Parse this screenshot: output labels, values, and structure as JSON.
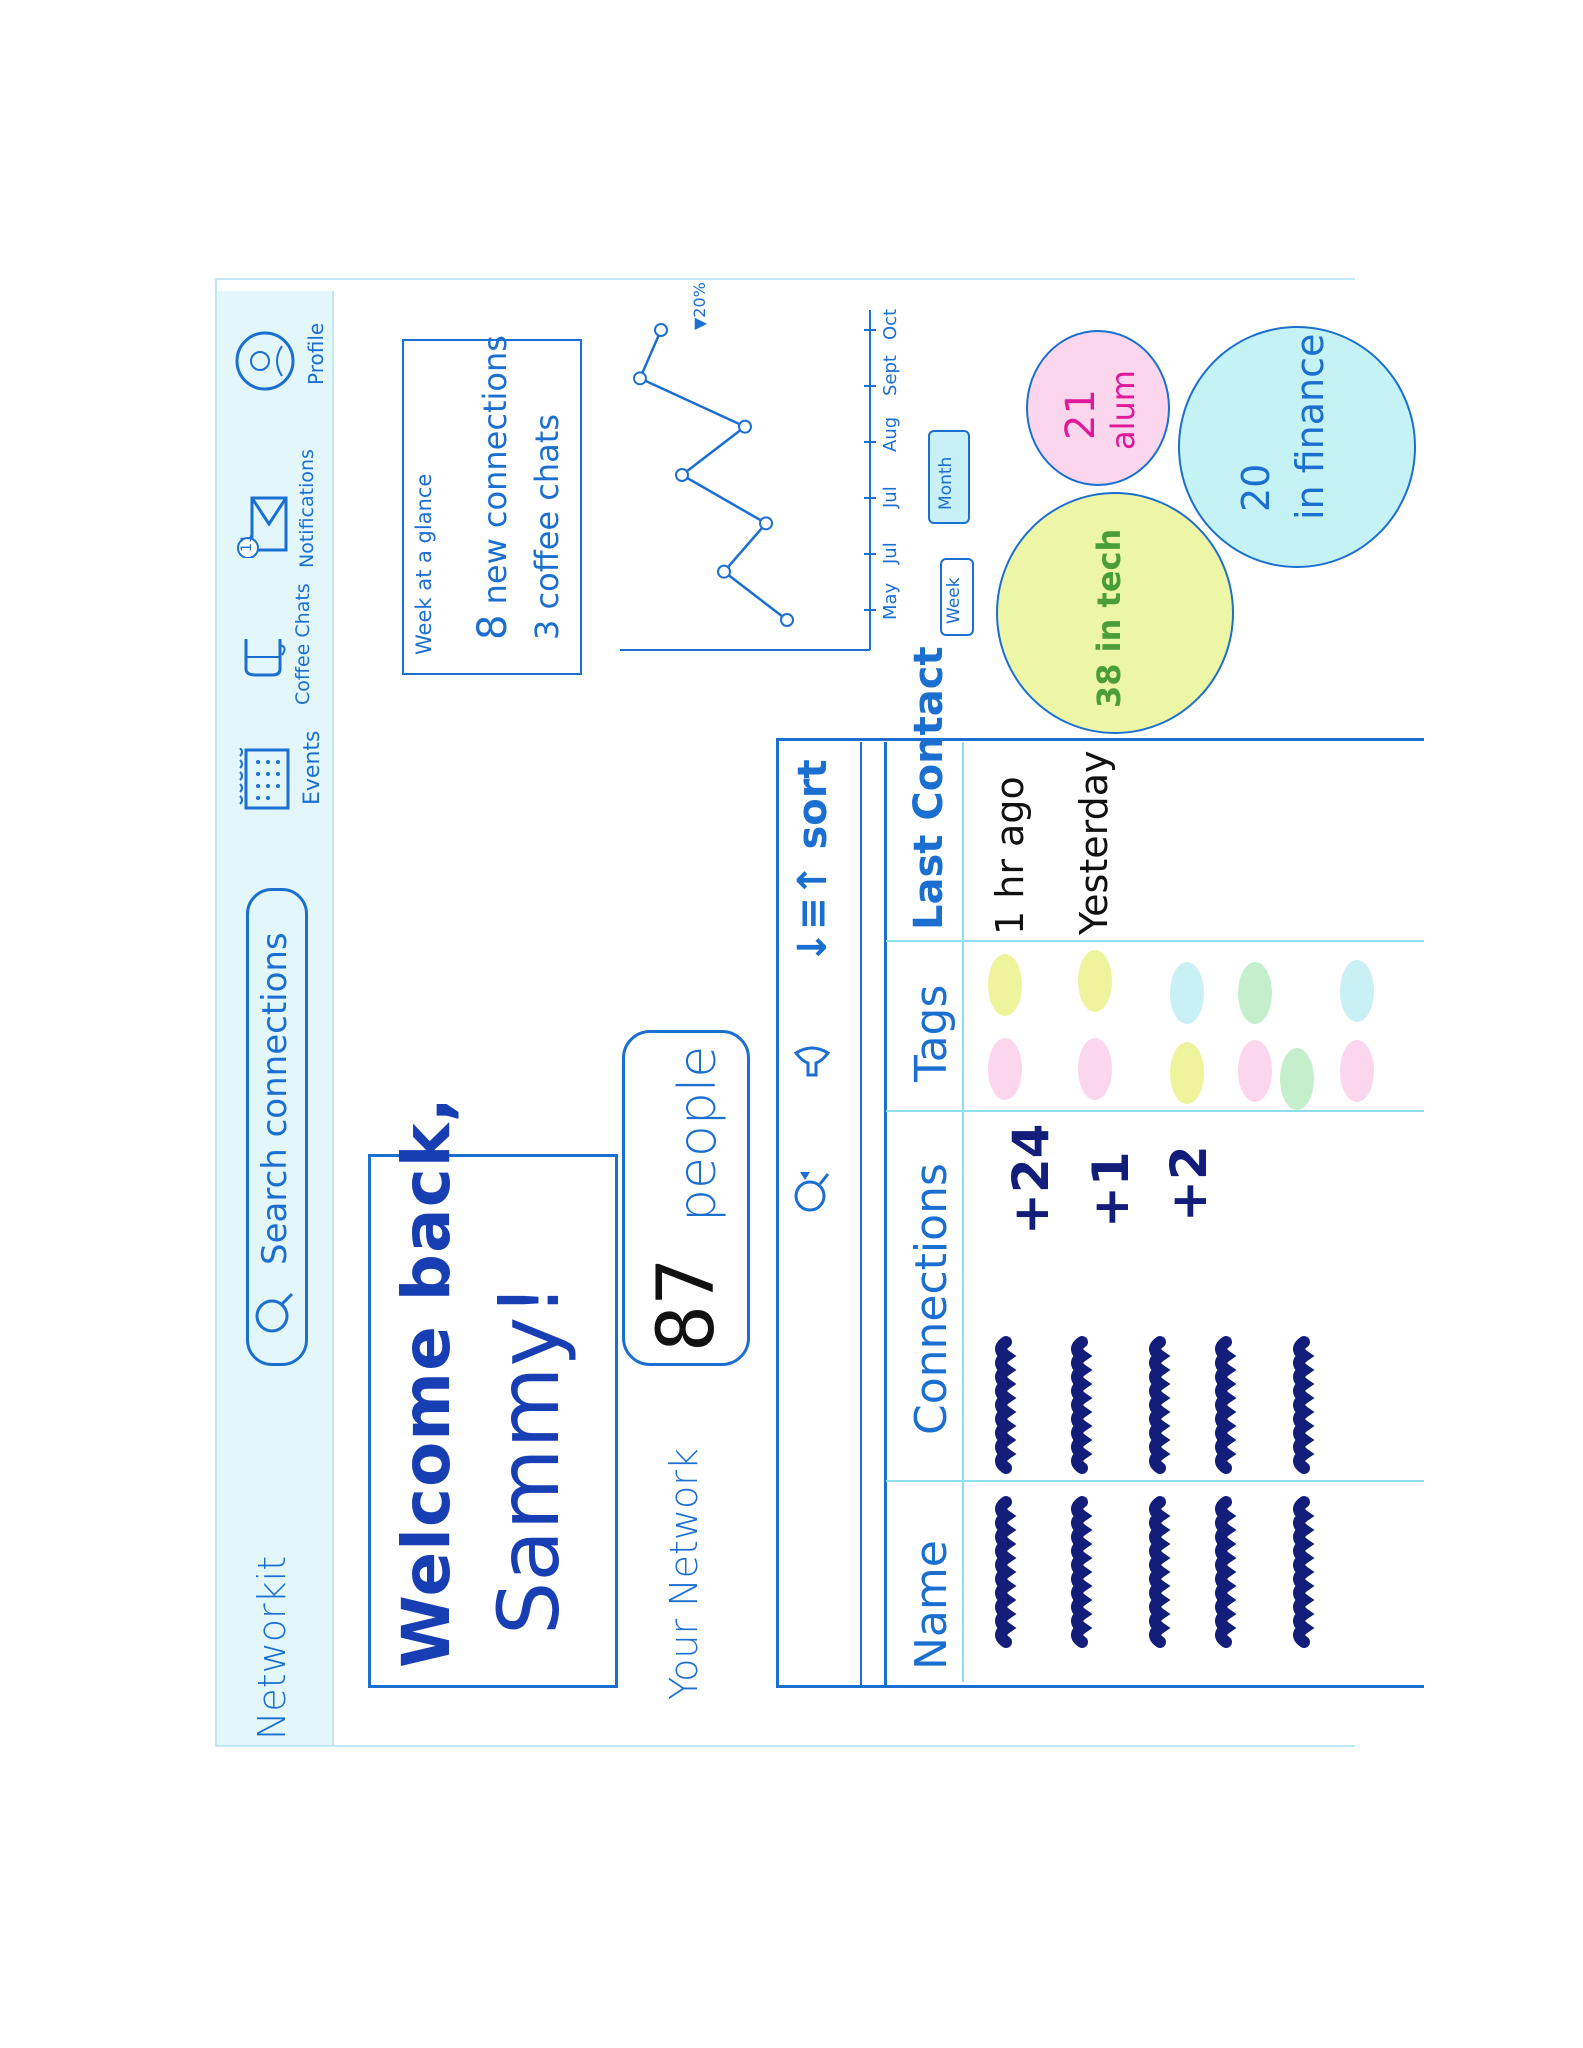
{
  "app": {
    "title": "Networkit"
  },
  "search": {
    "placeholder": "Search connections"
  },
  "nav": {
    "items": [
      {
        "label": "Events",
        "icon": "calendar-icon"
      },
      {
        "label": "Coffee Chats",
        "icon": "coffee-cup-icon"
      },
      {
        "label": "Notifications",
        "icon": "mail-icon",
        "badge": "11"
      },
      {
        "label": "Profile",
        "icon": "avatar-icon"
      }
    ]
  },
  "welcome": {
    "line1": "Welcome back,",
    "line2": "Sammy!"
  },
  "glance": {
    "title": "Week at a glance",
    "connections_count": "8",
    "connections_text": "new connections",
    "chats_count": "3",
    "chats_text": "coffee chats"
  },
  "network": {
    "label": "Your Network",
    "count": "87",
    "unit": "people"
  },
  "chart_data": {
    "type": "line",
    "x": [
      "May",
      "Jul",
      "Jul",
      "Aug",
      "Sept",
      "Oct"
    ],
    "values": [
      3,
      6,
      4,
      8,
      5,
      10,
      9
    ],
    "annotation": "▼20%",
    "toggle": {
      "week": "Week",
      "month": "Month",
      "active": "Month"
    },
    "accent": "#1b6fd0"
  },
  "toolbar": {
    "sort_label": "sort",
    "sort_symbol": "↓≡↑",
    "filter_icon": "filter-icon",
    "search_icon": "search-icon"
  },
  "table": {
    "headers": {
      "name": "Name",
      "connections": "Connections",
      "tags": "Tags",
      "last_contact": "Last Contact"
    },
    "rows": [
      {
        "mutual": "+24",
        "last_contact": "1 hr ago"
      },
      {
        "mutual": "+1",
        "last_contact": "Yesterday"
      },
      {
        "mutual": "+2",
        "last_contact": ""
      },
      {
        "mutual": "",
        "last_contact": ""
      },
      {
        "mutual": "",
        "last_contact": ""
      }
    ]
  },
  "stats": [
    {
      "count": "38",
      "label": "in tech",
      "color": "#e9f49a",
      "text_color": "#4a9e3a"
    },
    {
      "count": "21",
      "label": "alum",
      "color": "#fbd6ec",
      "text_color": "#e0189a"
    },
    {
      "count": "20",
      "label": "in finance",
      "color": "#c5f2f4",
      "text_color": "#1b6fd0"
    }
  ]
}
